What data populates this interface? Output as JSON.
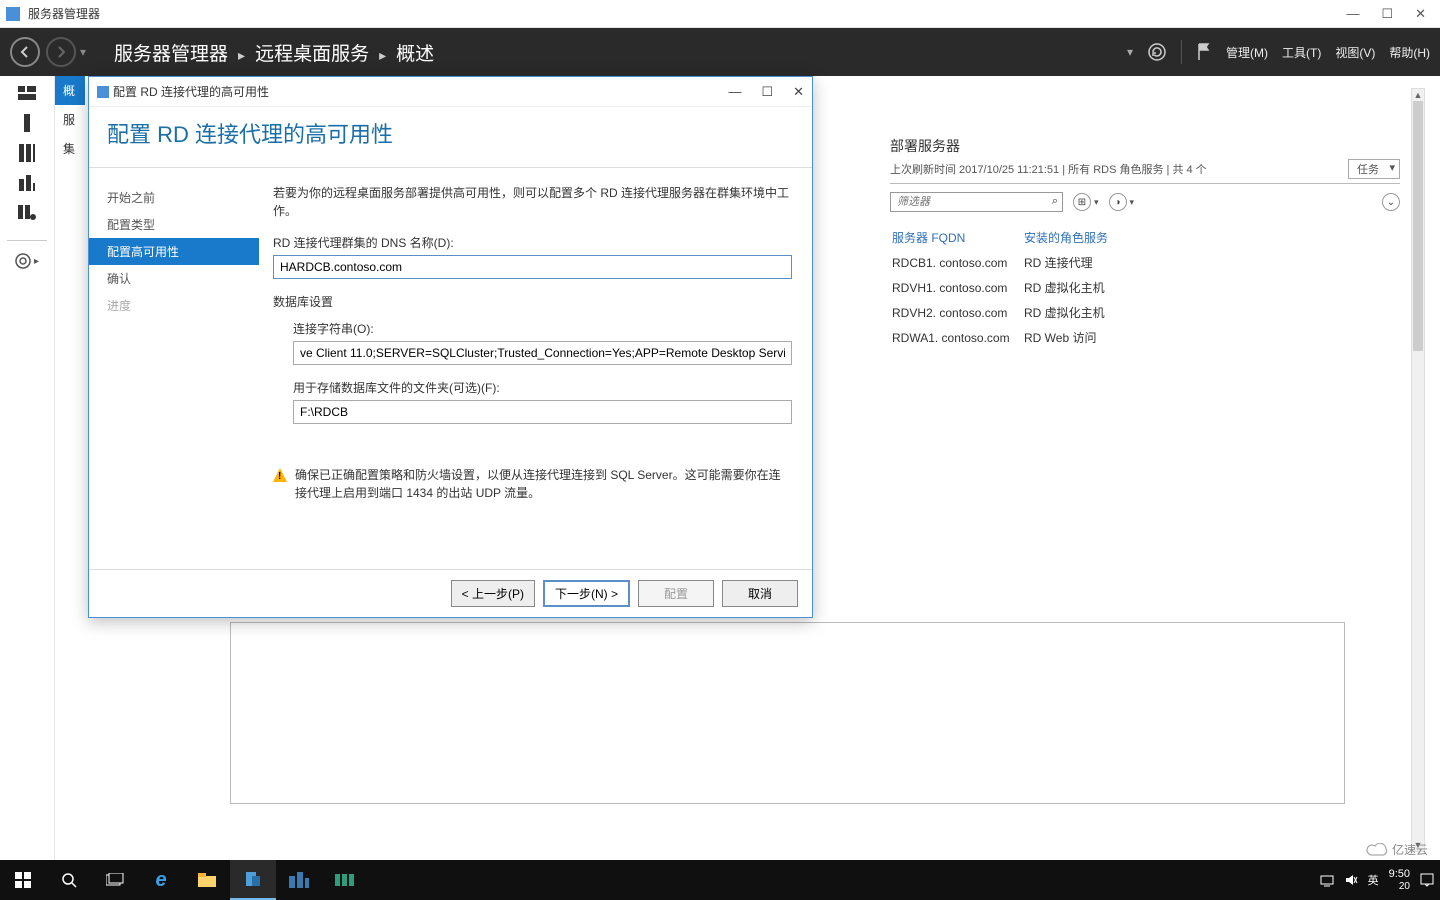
{
  "app": {
    "title": "服务器管理器"
  },
  "win_controls": {
    "min": "—",
    "max": "☐",
    "close": "✕"
  },
  "breadcrumb": {
    "root": "服务器管理器",
    "l1": "远程桌面服务",
    "l2": "概述",
    "sep": "▸"
  },
  "header_menus": {
    "manage": "管理(M)",
    "tools": "工具(T)",
    "view": "视图(V)",
    "help": "帮助(H)"
  },
  "secondary_nav": {
    "items": [
      "概",
      "服",
      "集"
    ]
  },
  "right_panel": {
    "title": "部署服务器",
    "subtitle": "上次刷新时间 2017/10/25 11:21:51 | 所有 RDS 角色服务  | 共 4 个",
    "tasks_label": "任务",
    "filter_placeholder": "筛选器",
    "col1": "服务器 FQDN",
    "col2": "安装的角色服务",
    "rows": [
      {
        "fqdn": "RDCB1. contoso.com",
        "role": "RD 连接代理"
      },
      {
        "fqdn": "RDVH1. contoso.com",
        "role": "RD 虚拟化主机"
      },
      {
        "fqdn": "RDVH2. contoso.com",
        "role": "RD 虚拟化主机"
      },
      {
        "fqdn": "RDWA1. contoso.com",
        "role": "RD Web 访问"
      }
    ]
  },
  "wizard": {
    "window_title": "配置 RD 连接代理的高可用性",
    "heading": "配置 RD 连接代理的高可用性",
    "steps": {
      "s1": "开始之前",
      "s2": "配置类型",
      "s3": "配置高可用性",
      "s4": "确认",
      "s5": "进度"
    },
    "intro": "若要为你的远程桌面服务部署提供高可用性，则可以配置多个 RD 连接代理服务器在群集环境中工作。",
    "dns_label": "RD 连接代理群集的 DNS 名称(D):",
    "dns_value": "HARDCB.contoso.com",
    "db_label": "数据库设置",
    "conn_label": "连接字符串(O):",
    "conn_value": "ve Client 11.0;SERVER=SQLCluster;Trusted_Connection=Yes;APP=Remote Desktop Servic",
    "folder_label": "用于存储数据库文件的文件夹(可选)(F):",
    "folder_value": "F:\\RDCB",
    "warning": "确保已正确配置策略和防火墙设置，以便从连接代理连接到 SQL Server。这可能需要你在连接代理上启用到端口 1434 的出站 UDP 流量。",
    "buttons": {
      "prev": "< 上一步(P)",
      "next": "下一步(N) >",
      "deploy": "配置",
      "cancel": "取消"
    }
  },
  "taskbar": {
    "time": "9:50",
    "date": "20",
    "ime": "英"
  },
  "watermark": "亿速云"
}
